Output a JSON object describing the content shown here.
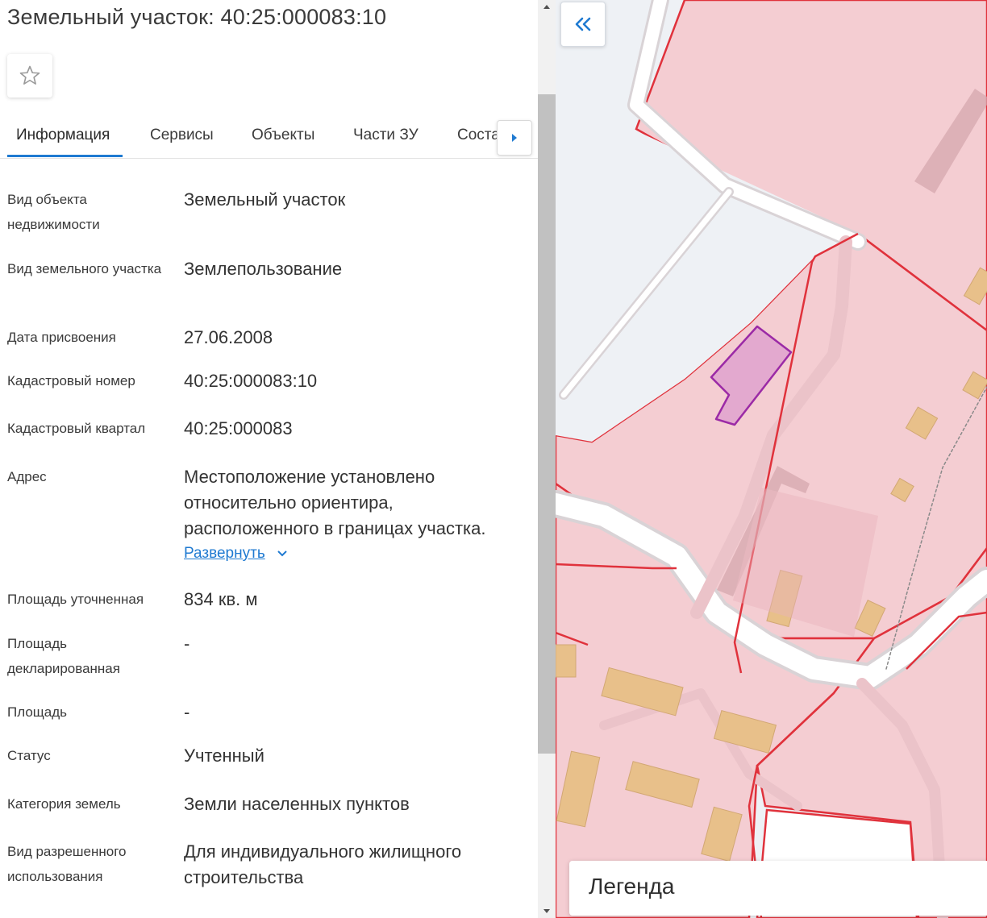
{
  "page": {
    "title": "Земельный участок: 40:25:000083:10"
  },
  "actions": {
    "favorite_icon": "star-outline-icon"
  },
  "tabs": [
    {
      "label": "Информация",
      "active": true
    },
    {
      "label": "Сервисы",
      "active": false
    },
    {
      "label": "Объекты",
      "active": false
    },
    {
      "label": "Части ЗУ",
      "active": false
    },
    {
      "label": "Состав ЗУ",
      "active": false
    }
  ],
  "tab_scroll_icon": "caret-right-icon",
  "info": {
    "object_type": {
      "label": "Вид объекта недвижимости",
      "value": "Земельный участок"
    },
    "plot_type": {
      "label": "Вид земельного участка",
      "value": "Землепользование"
    },
    "assigned_date": {
      "label": "Дата присвоения",
      "value": "27.06.2008"
    },
    "cadastral_number": {
      "label": "Кадастровый номер",
      "value": "40:25:000083:10"
    },
    "cadastral_quarter": {
      "label": "Кадастровый квартал",
      "value": "40:25:000083"
    },
    "address": {
      "label": "Адрес",
      "value": "Местоположение установлено относительно ориентира, расположенного в границах участка.",
      "expand_label": "Развернуть"
    },
    "area_specified": {
      "label": "Площадь уточненная",
      "value": "834 кв. м"
    },
    "area_declared": {
      "label": "Площадь декларированная",
      "value": "-"
    },
    "area": {
      "label": "Площадь",
      "value": "-"
    },
    "status": {
      "label": "Статус",
      "value": "Учтенный"
    },
    "land_category": {
      "label": "Категория земель",
      "value": "Земли населенных пунктов"
    },
    "permitted_use": {
      "label": "Вид разрешенного использования",
      "value": "Для индивидуального жилищного строительства"
    }
  },
  "map": {
    "collapse_icon": "double-chevron-left-icon",
    "legend_title": "Легенда",
    "colors": {
      "parcel_fill": "#f4cdd2",
      "parcel_border": "#e0323c",
      "road": "#ffffff",
      "building": "#e8c08a",
      "selected_fill": "#e3a9cf",
      "selected_border": "#9b2aa6",
      "background": "#eef1f5"
    }
  }
}
